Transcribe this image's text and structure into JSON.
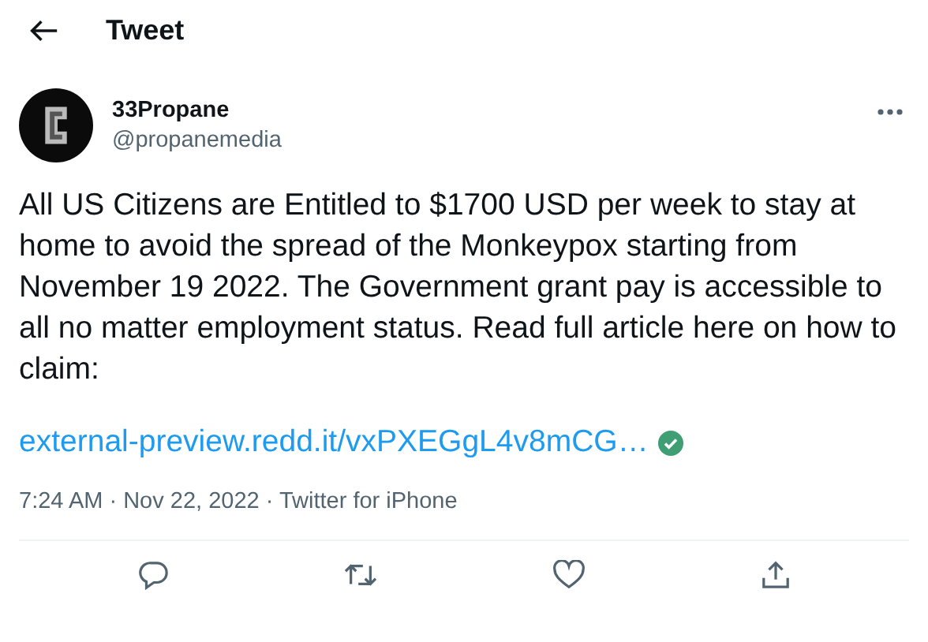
{
  "header": {
    "title": "Tweet"
  },
  "author": {
    "name": "33Propane",
    "handle": "@propanemedia"
  },
  "text": "All US Citizens are Entitled to $1700 USD per week to stay at home to avoid the spread of the Monkeypox starting from November 19 2022. The Government grant pay is accessible to all no matter employment status. Read full article here on how to claim:",
  "link": {
    "text": "external-preview.redd.it/vxPXEGgL4v8mCG…",
    "verified": true
  },
  "meta": "7:24 AM · Nov 22, 2022 · Twitter for iPhone"
}
